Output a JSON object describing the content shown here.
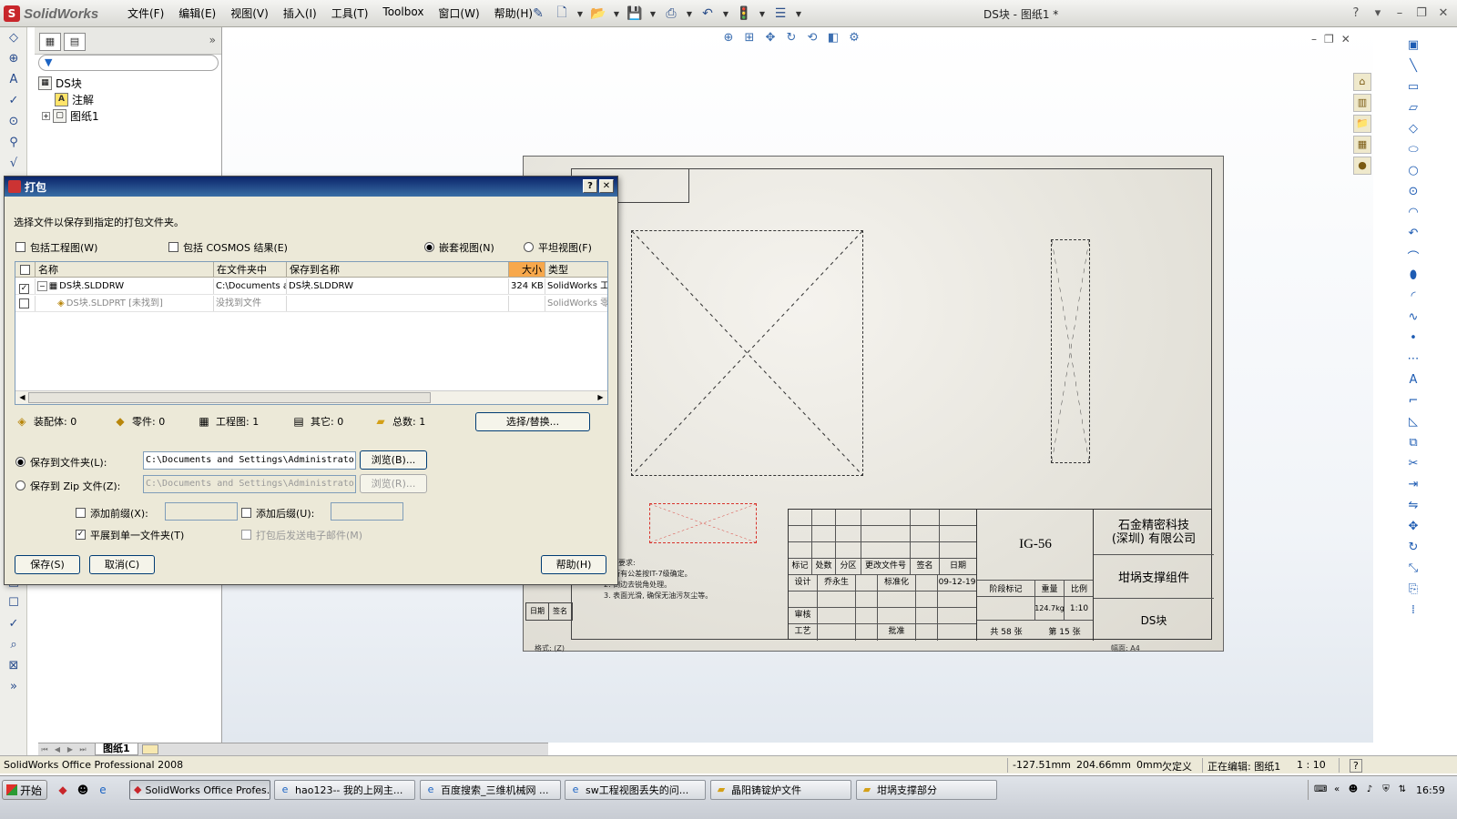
{
  "app": {
    "logo_mark": "S",
    "logo_text": "SolidWorks",
    "doc_title": "DS块 - 图纸1 *",
    "menu": [
      "文件(F)",
      "编辑(E)",
      "视图(V)",
      "插入(I)",
      "工具(T)",
      "Toolbox",
      "窗口(W)",
      "帮助(H)"
    ],
    "help_button": "?",
    "window_controls": [
      "–",
      "❐",
      "✕"
    ],
    "accent_color": "#c8262b"
  },
  "feature_manager": {
    "root": "DS块",
    "annotations": "注解",
    "sheet": "图纸1",
    "collapse_label": "»"
  },
  "sheet_tabs": {
    "active": "图纸1"
  },
  "drawing": {
    "part_code": "IG-56",
    "company_line1": "石金精密科技",
    "company_line2": "(深圳) 有限公司",
    "assembly_name": "坩埚支撑组件",
    "doc_name": "DS块",
    "designer": "乔永生",
    "standardizer": "标准化",
    "date": "09-12-19",
    "weight": "124.7kg",
    "scale": "1:10",
    "total_sheets": "共 58 张",
    "sheet_number": "第 15 张",
    "notes": [
      "技术要求:",
      "1. 所有公差按IT-7级确定。",
      "2. 倒边去锐角处理。",
      "3. 表面光滑, 确保无油污灰尘等。"
    ],
    "revision_labels": [
      "日期",
      "签名"
    ],
    "footer_left": "格式: (Z)",
    "footer_right": "幅面: A4",
    "tb_headers": [
      "标记",
      "处数",
      "分区",
      "更改文件号",
      "签名",
      "日期"
    ],
    "tb_labels": {
      "design": "设计",
      "review": "审核",
      "process": "工艺",
      "approve": "批准",
      "stage": "阶段标记",
      "weight": "重量",
      "scale": "比例"
    }
  },
  "dialog": {
    "title": "打包",
    "help_btn": "?",
    "close_btn": "✕",
    "instruction": "选择文件以保存到指定的打包文件夹。",
    "include_drawings": "包括工程图(W)",
    "include_cosmos": "包括 COSMOS 结果(E)",
    "nested_view": "嵌套视图(N)",
    "flat_view": "平坦视图(F)",
    "columns": [
      "名称",
      "在文件夹中",
      "保存到名称",
      "大小",
      "类型"
    ],
    "rows": [
      {
        "checked": "✓",
        "name": "DS块.SLDDRW",
        "folder": "C:\\Documents and",
        "save_name": "DS块.SLDDRW",
        "size": "324 KB",
        "type": "SolidWorks 工"
      },
      {
        "checked": "",
        "name": "DS块.SLDPRT [未找到]",
        "folder": "没找到文件",
        "save_name": "",
        "size": "",
        "type": "SolidWorks 零"
      }
    ],
    "counts": {
      "assemblies": "装配体: 0",
      "parts": "零件: 0",
      "drawings": "工程图: 1",
      "other": "其它: 0",
      "total": "总数: 1"
    },
    "select_replace": "选择/替换...",
    "save_to_folder": "保存到文件夹(L):",
    "folder_path": "C:\\Documents and Settings\\Administrator",
    "browse": "浏览(B)...",
    "save_to_zip": "保存到 Zip 文件(Z):",
    "zip_path": "C:\\Documents and Settings\\Administrator",
    "browse_disabled": "浏览(R)...",
    "add_prefix": "添加前缀(X):",
    "add_suffix": "添加后缀(U):",
    "flatten": "平展到单一文件夹(T)",
    "email_after": "打包后发送电子邮件(M)",
    "save": "保存(S)",
    "cancel": "取消(C)",
    "help": "帮助(H)"
  },
  "status": {
    "product": "SolidWorks Office Professional 2008",
    "x": "-127.51mm",
    "y": "204.66mm",
    "z": "0mm",
    "state": "欠定义",
    "editing": "正在编辑: 图纸1",
    "scale": "1 : 10",
    "help": "?"
  },
  "taskbar": {
    "start": "开始",
    "tasks": [
      "SolidWorks Office Profes...",
      "hao123-- 我的上网主...",
      "百度搜索_三维机械网 ...",
      "sw工程视图丢失的问...",
      "晶阳铸锭炉文件",
      "坩埚支撑部分"
    ],
    "clock": "16:59",
    "tray_expand": "«"
  }
}
